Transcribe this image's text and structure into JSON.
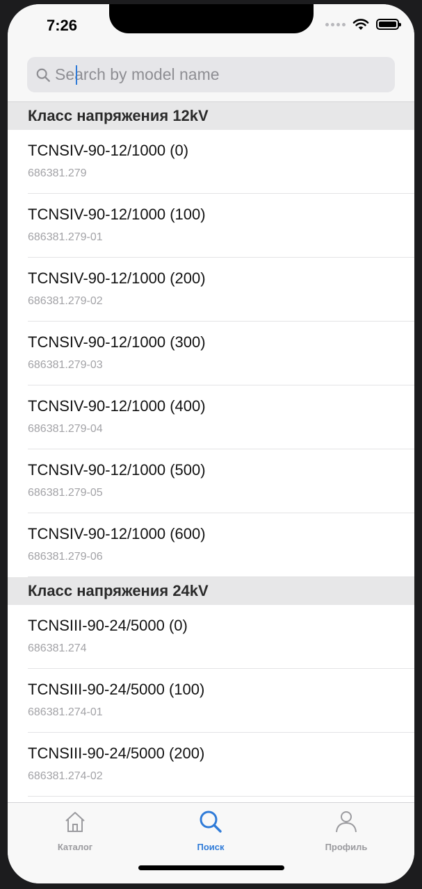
{
  "status_bar": {
    "time": "7:26"
  },
  "search": {
    "placeholder": "Search by model name",
    "value": ""
  },
  "sections": [
    {
      "title": "Класс напряжения 12kV",
      "items": [
        {
          "name": "TCNSIV-90-12/1000 (0)",
          "code": "686381.279"
        },
        {
          "name": "TCNSIV-90-12/1000 (100)",
          "code": "686381.279-01"
        },
        {
          "name": "TCNSIV-90-12/1000 (200)",
          "code": "686381.279-02"
        },
        {
          "name": "TCNSIV-90-12/1000 (300)",
          "code": "686381.279-03"
        },
        {
          "name": "TCNSIV-90-12/1000 (400)",
          "code": "686381.279-04"
        },
        {
          "name": "TCNSIV-90-12/1000 (500)",
          "code": "686381.279-05"
        },
        {
          "name": "TCNSIV-90-12/1000 (600)",
          "code": "686381.279-06"
        }
      ]
    },
    {
      "title": "Класс напряжения 24kV",
      "items": [
        {
          "name": "TCNSIII-90-24/5000 (0)",
          "code": "686381.274"
        },
        {
          "name": "TCNSIII-90-24/5000 (100)",
          "code": "686381.274-01"
        },
        {
          "name": "TCNSIII-90-24/5000 (200)",
          "code": "686381.274-02"
        }
      ]
    }
  ],
  "tabs": [
    {
      "label": "Каталог",
      "icon": "home-icon",
      "active": false
    },
    {
      "label": "Поиск",
      "icon": "search-icon",
      "active": true
    },
    {
      "label": "Профиль",
      "icon": "profile-icon",
      "active": false
    }
  ],
  "colors": {
    "accent": "#2f7bd8",
    "inactive": "#9a9a9e",
    "section_bg": "#e7e7e8"
  }
}
